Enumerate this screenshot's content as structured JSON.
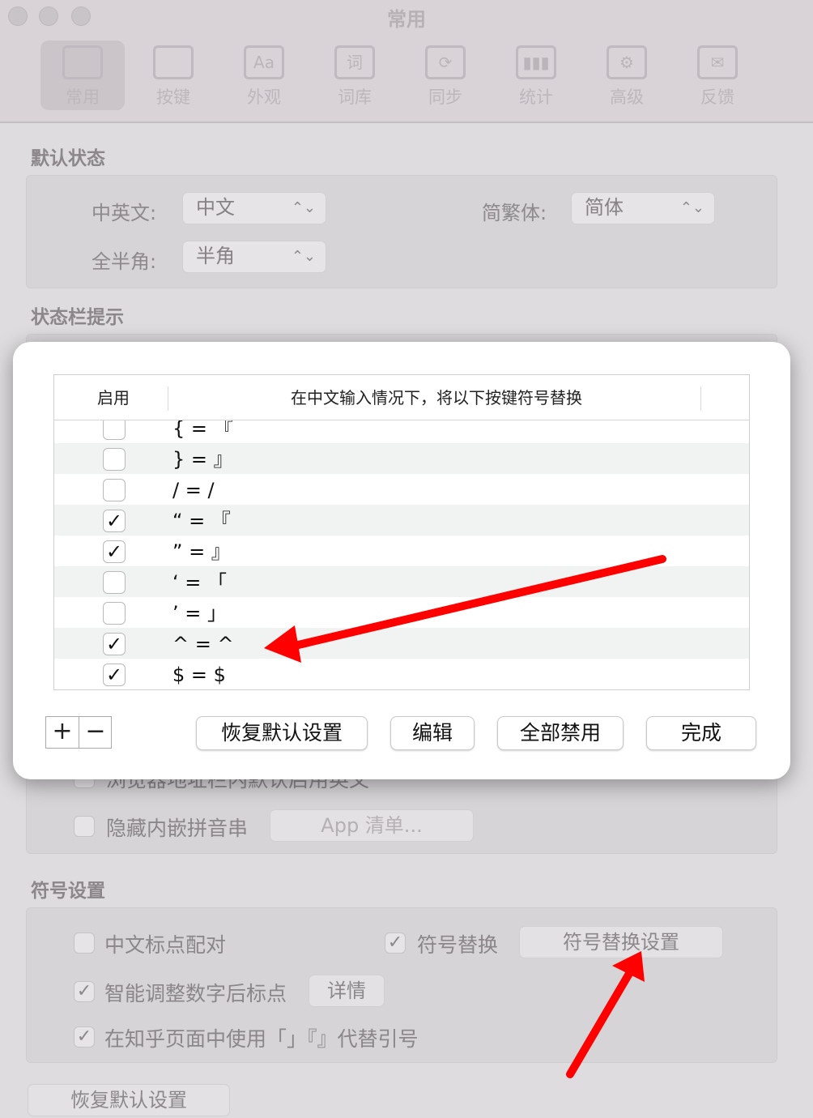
{
  "window": {
    "title": "常用",
    "toolbar": [
      {
        "label": "常用",
        "icon": "general-icon",
        "glyph": ""
      },
      {
        "label": "按键",
        "icon": "keys-icon",
        "glyph": ""
      },
      {
        "label": "外观",
        "icon": "appearance-icon",
        "glyph": "Aa"
      },
      {
        "label": "词库",
        "icon": "dictionary-icon",
        "glyph": "词"
      },
      {
        "label": "同步",
        "icon": "sync-icon",
        "glyph": "⟳"
      },
      {
        "label": "统计",
        "icon": "stats-icon",
        "glyph": "▮▮▮"
      },
      {
        "label": "高级",
        "icon": "gear-icon",
        "glyph": "⚙"
      },
      {
        "label": "反馈",
        "icon": "mail-icon",
        "glyph": "✉"
      }
    ]
  },
  "default_state": {
    "title": "默认状态",
    "cn_en_label": "中英文:",
    "cn_en_value": "中文",
    "simp_trad_label": "简繁体:",
    "simp_trad_value": "简体",
    "width_label": "全半角:",
    "width_value": "半角"
  },
  "status_bar": {
    "title": "状态栏提示",
    "partial_item": "浏览器地址栏内默认启用英文",
    "hide_inline_pinyin": "隐藏内嵌拼音串",
    "app_list_button": "App 清单..."
  },
  "symbol_settings": {
    "title": "符号设置",
    "cn_punct_pairing": "中文标点配对",
    "symbol_replace": "符号替换",
    "symbol_replace_settings": "符号替换设置",
    "smart_punct": "智能调整数字后标点",
    "details_button": "详情",
    "zhihu_quotes": "在知乎页面中使用「」『』代替引号",
    "restore_default": "恢复默认设置"
  },
  "sheet": {
    "col_enabled": "启用",
    "col_rule": "在中文输入情况下，将以下按键符号替换",
    "rows": [
      {
        "rule": "{ = 『",
        "checked": false
      },
      {
        "rule": "} = 』",
        "checked": false
      },
      {
        "rule": "/ = /",
        "checked": false
      },
      {
        "rule": "“ = 『",
        "checked": true
      },
      {
        "rule": "” = 』",
        "checked": true
      },
      {
        "rule": "‘ = 「",
        "checked": false
      },
      {
        "rule": "’ = 」",
        "checked": false
      },
      {
        "rule": "^ = ^",
        "checked": true
      },
      {
        "rule": "$ = $",
        "checked": true
      }
    ],
    "add_symbol": "+",
    "remove_symbol": "−",
    "restore_default": "恢复默认设置",
    "edit": "编辑",
    "disable_all": "全部禁用",
    "done": "完成"
  },
  "check_glyph": "✓",
  "colors": {
    "annotation_arrow": "#ff0000"
  }
}
